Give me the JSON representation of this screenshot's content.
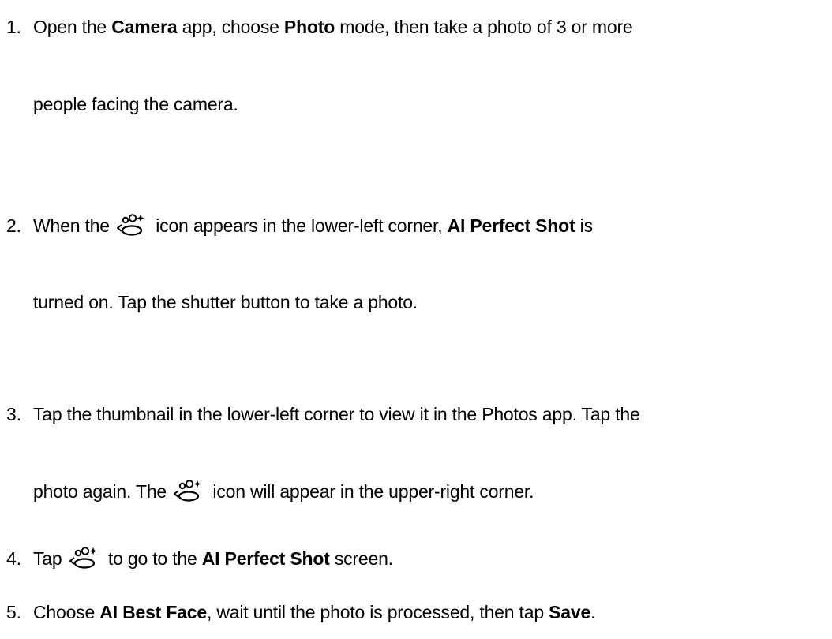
{
  "steps": [
    {
      "number": "1.",
      "line1": {
        "t1": "Open the ",
        "b1": "Camera",
        "t2": " app, choose ",
        "b2": "Photo",
        "t3": " mode, then take a photo of 3 or more"
      },
      "line2": {
        "t1": "people facing the camera."
      }
    },
    {
      "number": "2.",
      "line1": {
        "t1": "When the ",
        "icon": "ai-perfect-shot-icon",
        "t2": " icon appears in the lower-left corner, ",
        "b1": "AI Perfect Shot",
        "t3": " is"
      },
      "line2": {
        "t1": "turned on. Tap the shutter button to take a photo."
      }
    },
    {
      "number": "3.",
      "line1": {
        "t1": "Tap the thumbnail in the lower-left corner to view it in the Photos app. Tap the"
      },
      "line2": {
        "t1": "photo again. The ",
        "icon": "ai-perfect-shot-icon",
        "t2": " icon will appear in the upper-right corner."
      }
    },
    {
      "number": "4.",
      "line1": {
        "t1": "Tap ",
        "icon": "ai-perfect-shot-icon",
        "t2": " to go to the ",
        "b1": "AI Perfect Shot",
        "t3": " screen."
      }
    },
    {
      "number": "5.",
      "line1": {
        "t1": "Choose ",
        "b1": "AI Best Face",
        "t2": ", wait until the photo is processed, then tap ",
        "b2": "Save",
        "t3": "."
      }
    }
  ]
}
